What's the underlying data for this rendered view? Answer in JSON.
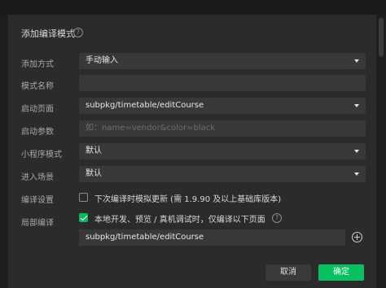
{
  "dialog": {
    "title": "添加编译模式",
    "help_glyph": "?"
  },
  "rows": {
    "add_method": {
      "label": "添加方式",
      "value": "手动输入"
    },
    "mode_name": {
      "label": "模式名称",
      "value": ""
    },
    "launch_page": {
      "label": "启动页面",
      "value": "subpkg/timetable/editCourse"
    },
    "launch_params": {
      "label": "启动参数",
      "placeholder": "如：name=vendor&color=black"
    },
    "mini_program_mode": {
      "label": "小程序模式",
      "value": "默认"
    },
    "entry_scene": {
      "label": "进入场景",
      "value": "默认"
    },
    "compile_settings": {
      "label": "编译设置",
      "checkbox_label": "下次编译时模拟更新 (需 1.9.90 及以上基础库版本)",
      "checked": false
    },
    "partial_compile": {
      "label": "局部编译",
      "checkbox_label": "本地开发、预览 / 真机调试时，仅编译以下页面",
      "checked": true,
      "page": "subpkg/timetable/editCourse"
    }
  },
  "buttons": {
    "cancel": "取消",
    "confirm": "确定"
  },
  "colors": {
    "accent": "#07c160",
    "background": "#2b2b2b"
  }
}
